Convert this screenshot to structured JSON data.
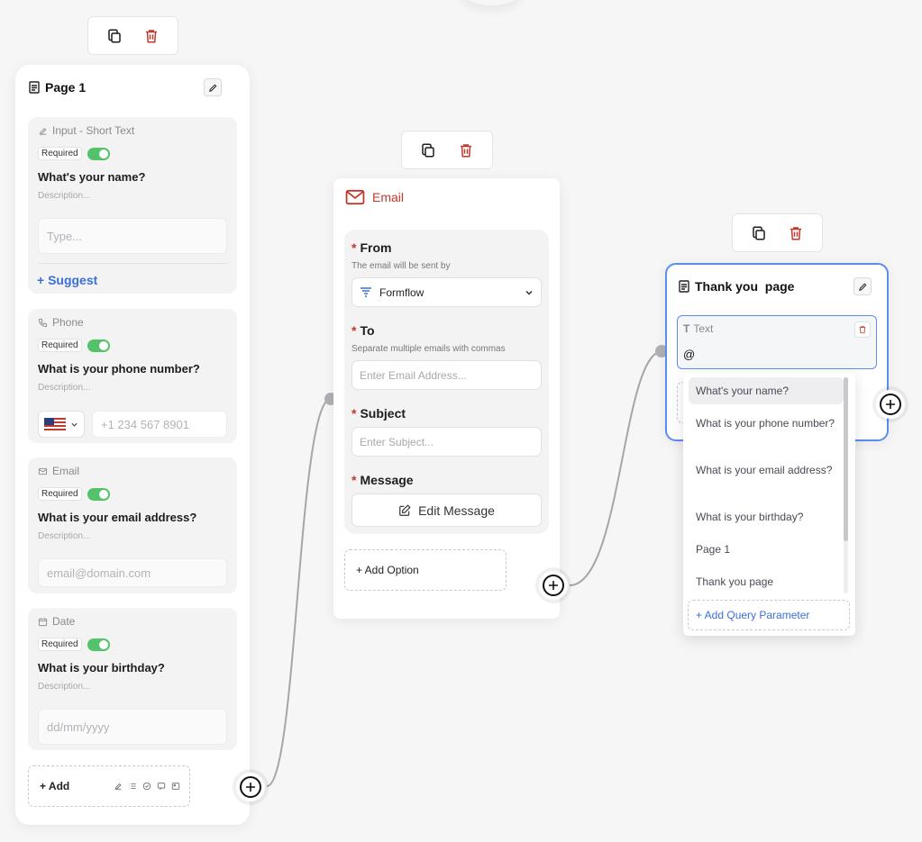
{
  "connectors": {},
  "page1": {
    "title": "Page 1",
    "fields": [
      {
        "type_label": "Input - Short Text",
        "type_icon": "edit-icon",
        "required_label": "Required",
        "question": "What's your name?",
        "description": "Description...",
        "placeholder": "Type...",
        "suggest_label": "+ Suggest"
      },
      {
        "type_label": "Phone",
        "type_icon": "phone-icon",
        "required_label": "Required",
        "question": "What is your phone number?",
        "description": "Description...",
        "placeholder": "+1 234 567 8901"
      },
      {
        "type_label": "Email",
        "type_icon": "mail-icon",
        "required_label": "Required",
        "question": "What is your email address?",
        "description": "Description...",
        "placeholder": "email@domain.com"
      },
      {
        "type_label": "Date",
        "type_icon": "calendar-icon",
        "required_label": "Required",
        "question": "What is your birthday?",
        "description": "Description...",
        "placeholder": "dd/mm/yyyy"
      }
    ],
    "add_label": "+ Add"
  },
  "email_node": {
    "title": "Email",
    "from_label": "From",
    "from_sub": "The email will be sent by",
    "from_value": "Formflow",
    "to_label": "To",
    "to_sub": "Separate multiple emails with commas",
    "to_placeholder": "Enter Email Address...",
    "subject_label": "Subject",
    "subject_placeholder": "Enter Subject...",
    "message_label": "Message",
    "edit_message_label": "Edit Message",
    "add_option_label": "+ Add Option",
    "required_mark": "*"
  },
  "thank_you": {
    "title": "Thank you  page",
    "text_block_label": "Text",
    "text_value": "@",
    "dropdown_items": [
      "What's your name?",
      "What is your phone number?",
      "What is your email address?",
      "What is your birthday?",
      "Page 1",
      "Thank you page"
    ],
    "add_query_label": "+ Add Query Parameter"
  },
  "colors": {
    "accent_red": "#c0392b",
    "toggle_green": "#54c26a",
    "link_blue": "#3b6fd8",
    "selected_border": "#5b8def"
  }
}
